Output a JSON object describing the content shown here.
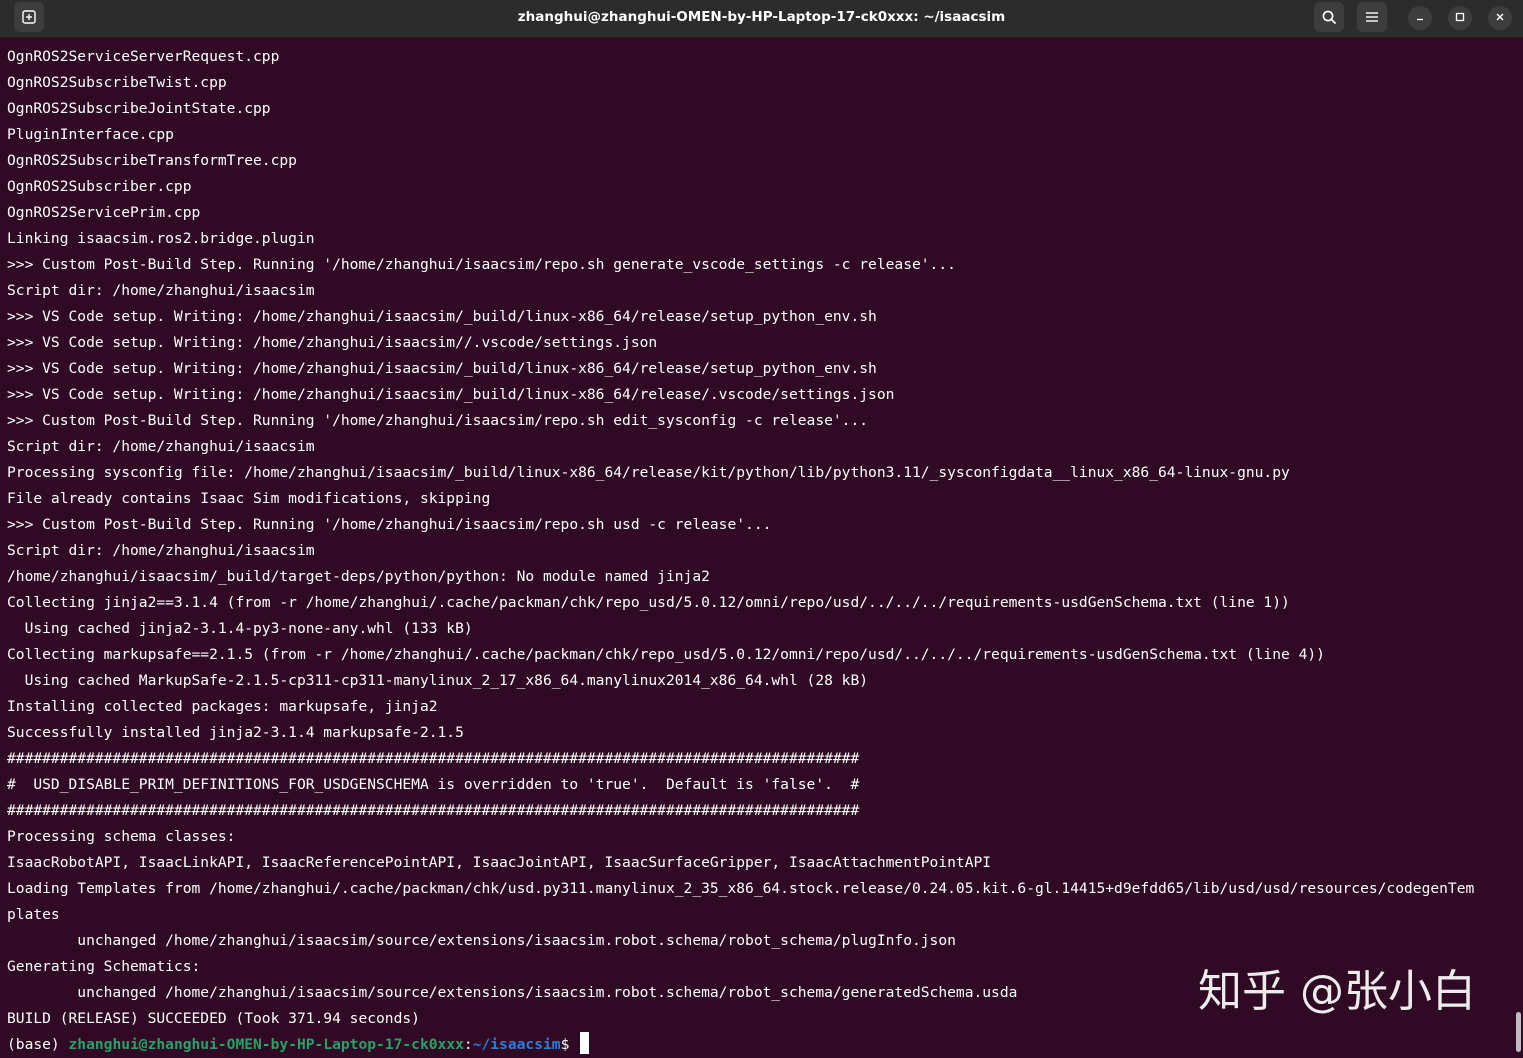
{
  "window": {
    "title": "zhanghui@zhanghui-OMEN-by-HP-Laptop-17-ck0xxx: ~/isaacsim",
    "controls": {
      "new_tab_icon": "new-tab-icon",
      "search_icon": "search-icon",
      "menu_icon": "hamburger-menu-icon",
      "minimize_icon": "minimize-icon",
      "maximize_icon": "maximize-icon",
      "close_icon": "close-icon"
    }
  },
  "terminal": {
    "lines": [
      "OgnROS2ServiceServerRequest.cpp",
      "OgnROS2SubscribeTwist.cpp",
      "OgnROS2SubscribeJointState.cpp",
      "PluginInterface.cpp",
      "OgnROS2SubscribeTransformTree.cpp",
      "OgnROS2Subscriber.cpp",
      "OgnROS2ServicePrim.cpp",
      "Linking isaacsim.ros2.bridge.plugin",
      ">>> Custom Post-Build Step. Running '/home/zhanghui/isaacsim/repo.sh generate_vscode_settings -c release'...",
      "Script dir: /home/zhanghui/isaacsim",
      ">>> VS Code setup. Writing: /home/zhanghui/isaacsim/_build/linux-x86_64/release/setup_python_env.sh",
      ">>> VS Code setup. Writing: /home/zhanghui/isaacsim//.vscode/settings.json",
      ">>> VS Code setup. Writing: /home/zhanghui/isaacsim/_build/linux-x86_64/release/setup_python_env.sh",
      ">>> VS Code setup. Writing: /home/zhanghui/isaacsim/_build/linux-x86_64/release/.vscode/settings.json",
      ">>> Custom Post-Build Step. Running '/home/zhanghui/isaacsim/repo.sh edit_sysconfig -c release'...",
      "Script dir: /home/zhanghui/isaacsim",
      "Processing sysconfig file: /home/zhanghui/isaacsim/_build/linux-x86_64/release/kit/python/lib/python3.11/_sysconfigdata__linux_x86_64-linux-gnu.py",
      "File already contains Isaac Sim modifications, skipping",
      ">>> Custom Post-Build Step. Running '/home/zhanghui/isaacsim/repo.sh usd -c release'...",
      "Script dir: /home/zhanghui/isaacsim",
      "/home/zhanghui/isaacsim/_build/target-deps/python/python: No module named jinja2",
      "Collecting jinja2==3.1.4 (from -r /home/zhanghui/.cache/packman/chk/repo_usd/5.0.12/omni/repo/usd/../../../requirements-usdGenSchema.txt (line 1))",
      "  Using cached jinja2-3.1.4-py3-none-any.whl (133 kB)",
      "Collecting markupsafe==2.1.5 (from -r /home/zhanghui/.cache/packman/chk/repo_usd/5.0.12/omni/repo/usd/../../../requirements-usdGenSchema.txt (line 4))",
      "  Using cached MarkupSafe-2.1.5-cp311-cp311-manylinux_2_17_x86_64.manylinux2014_x86_64.whl (28 kB)",
      "Installing collected packages: markupsafe, jinja2",
      "Successfully installed jinja2-3.1.4 markupsafe-2.1.5",
      "#################################################################################################",
      "#  USD_DISABLE_PRIM_DEFINITIONS_FOR_USDGENSCHEMA is overridden to 'true'.  Default is 'false'.  #",
      "#################################################################################################",
      "Processing schema classes:",
      "IsaacRobotAPI, IsaacLinkAPI, IsaacReferencePointAPI, IsaacJointAPI, IsaacSurfaceGripper, IsaacAttachmentPointAPI",
      "Loading Templates from /home/zhanghui/.cache/packman/chk/usd.py311.manylinux_2_35_x86_64.stock.release/0.24.05.kit.6-gl.14415+d9efdd65/lib/usd/usd/resources/codegenTem",
      "plates",
      "        unchanged /home/zhanghui/isaacsim/source/extensions/isaacsim.robot.schema/robot_schema/plugInfo.json",
      "Generating Schematics:",
      "        unchanged /home/zhanghui/isaacsim/source/extensions/isaacsim.robot.schema/robot_schema/generatedSchema.usda",
      "BUILD (RELEASE) SUCCEEDED (Took 371.94 seconds)"
    ],
    "prompt": {
      "env": "(base) ",
      "user_host": "zhanghui@zhanghui-OMEN-by-HP-Laptop-17-ck0xxx",
      "separator": ":",
      "path": "~/isaacsim",
      "symbol": "$ "
    }
  },
  "watermark": {
    "text": "知乎 @张小白"
  },
  "colors": {
    "background": "#300a24",
    "titlebar": "#2c2c2c",
    "text": "#ffffff",
    "prompt_user": "#26a269",
    "prompt_path": "#2a7bde"
  }
}
